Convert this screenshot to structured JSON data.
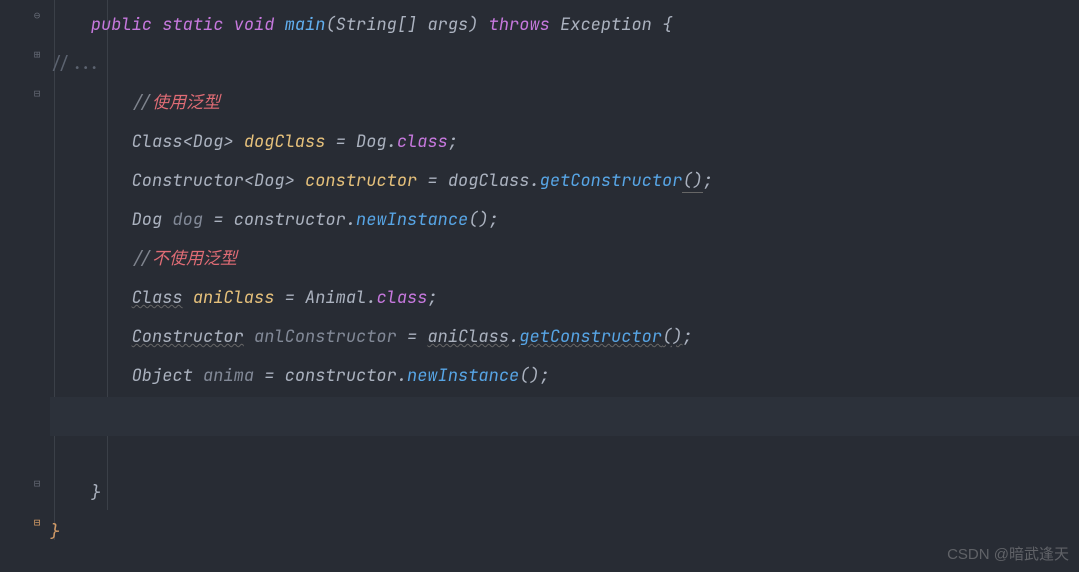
{
  "code": {
    "line1": {
      "public": "public",
      "static": "static",
      "void": "void",
      "main": "main",
      "params": "(String[] args)",
      "throws": "throws",
      "exception": "Exception",
      "brace": " {"
    },
    "line2": {
      "fold": "//..."
    },
    "line3": {
      "slashes": "//",
      "text": "使用泛型"
    },
    "line4": {
      "class": "Class",
      "generic": "<Dog>",
      "var": "dogClass",
      "eq": " = ",
      "dog": "Dog",
      "dot": ".",
      "cls": "class",
      "semi": ";"
    },
    "line5": {
      "ctor": "Constructor",
      "generic": "<Dog>",
      "var": "constructor",
      "eq": " = ",
      "obj": "dogClass",
      "dot": ".",
      "call": "getConstructor",
      "parens": "()",
      "semi": ";"
    },
    "line6": {
      "type": "Dog",
      "var": "dog",
      "eq": " = ",
      "obj": "constructor",
      "dot": ".",
      "call": "newInstance",
      "parens": "()",
      "semi": ";"
    },
    "line7": {
      "slashes": "//",
      "text": "不使用泛型"
    },
    "line8": {
      "class": "Class",
      "var": "aniClass",
      "eq": " = ",
      "animal": "Animal",
      "dot": ".",
      "cls": "class",
      "semi": ";"
    },
    "line9": {
      "ctor": "Constructor",
      "var": "anlConstructor",
      "eq": " = ",
      "obj": "aniClass",
      "dot": ".",
      "call": "getConstructor",
      "parens": "()",
      "semi": ";"
    },
    "line10": {
      "type": "Object",
      "var": "anima",
      "eq": " = ",
      "obj": "constructor",
      "dot": ".",
      "call": "newInstance",
      "parens": "()",
      "semi": ";"
    },
    "line13": {
      "brace": "}"
    },
    "line14": {
      "brace": "}"
    }
  },
  "watermark": "CSDN @暗武逢天",
  "indent1": "    ",
  "indent2": "        ",
  "space": " "
}
